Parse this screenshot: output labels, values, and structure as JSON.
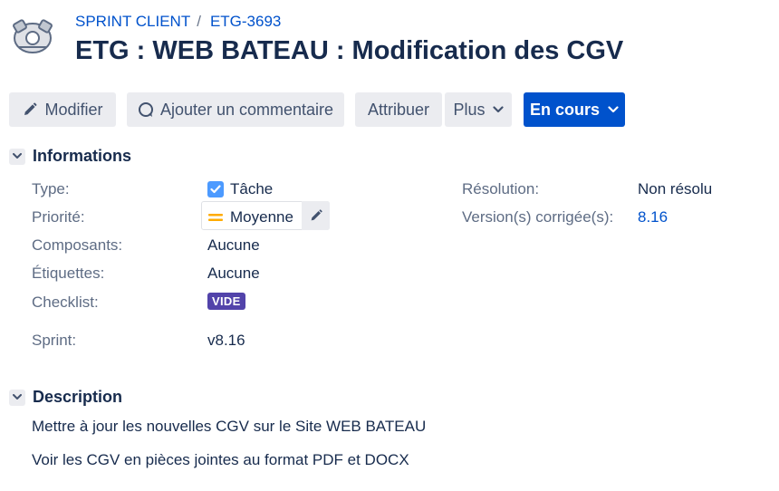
{
  "breadcrumb": {
    "project": "SPRINT CLIENT",
    "separator": "/",
    "issue_key": "ETG-3693"
  },
  "issue": {
    "title": "ETG : WEB BATEAU : Modification des CGV"
  },
  "toolbar": {
    "edit_label": "Modifier",
    "comment_label": "Ajouter un commentaire",
    "assign_label": "Attribuer",
    "more_label": "Plus",
    "status_label": "En cours"
  },
  "details": {
    "section_title": "Informations",
    "type_label": "Type:",
    "type_value": "Tâche",
    "priority_label": "Priorité:",
    "priority_value": "Moyenne",
    "components_label": "Composants:",
    "components_value": "Aucune",
    "labels_label": "Étiquettes:",
    "labels_value": "Aucune",
    "checklist_label": "Checklist:",
    "checklist_value": "VIDE",
    "sprint_label": "Sprint:",
    "sprint_value": "v8.16",
    "resolution_label": "Résolution:",
    "resolution_value": "Non résolu",
    "fix_versions_label": "Version(s) corrigée(s):",
    "fix_versions_value": "8.16"
  },
  "description": {
    "section_title": "Description",
    "lines": [
      "Mettre à jour les nouvelles CGV sur le Site WEB BATEAU",
      "Voir les CGV en pièces jointes au format PDF et DOCX"
    ]
  },
  "colors": {
    "brand": "#0052cc",
    "badge": "#5243aa",
    "priority_medium": "#ffab00",
    "type_task": "#4c9aff"
  },
  "icons": [
    "project-avatar-icon",
    "pencil-icon",
    "comment-icon",
    "chevron-down-icon",
    "checkbox-icon",
    "priority-medium-icon"
  ]
}
